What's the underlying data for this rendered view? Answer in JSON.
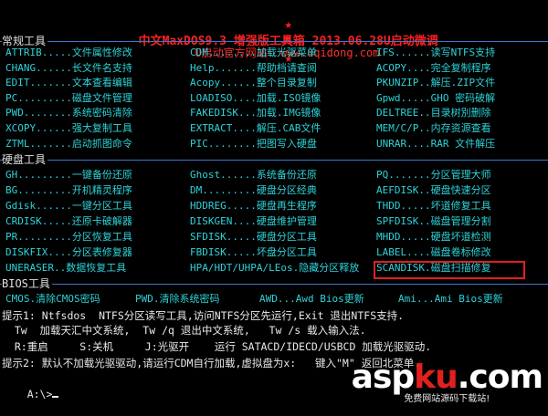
{
  "header": {
    "title": "中文MaxDOS9.3 增强版工具箱 2013.06.28U启动微调",
    "subtitle": "U启动官方网站: www.uqidong.com",
    "star": "★"
  },
  "sections": {
    "common": "常规工具",
    "disk": "硬盘工具",
    "bios": "BIOS工具"
  },
  "common_rows": [
    [
      {
        "cmd": "ATTRIB",
        "dots": ".....",
        "desc": "文件属性修改"
      },
      {
        "cmd": "CDM",
        "dots": "........",
        "desc": "加载光驱菜单"
      },
      {
        "cmd": "IFS",
        "dots": "......",
        "desc": "读写NTFS支持"
      }
    ],
    [
      {
        "cmd": "CHANG",
        "dots": "......",
        "desc": "长文件名支持"
      },
      {
        "cmd": "Help",
        "dots": ".......",
        "desc": "帮助档请查阅"
      },
      {
        "cmd": "ACOPY",
        "dots": "....",
        "desc": "完全复制程序"
      }
    ],
    [
      {
        "cmd": "EDIT",
        "dots": ".......",
        "desc": "文本查看编辑"
      },
      {
        "cmd": "Acopy",
        "dots": "......",
        "desc": "整个目录复制"
      },
      {
        "cmd": "PKUNZIP",
        "dots": "..",
        "desc": "解压.ZIP文件"
      }
    ],
    [
      {
        "cmd": "PC",
        "dots": ".........",
        "desc": "磁盘文件管理"
      },
      {
        "cmd": "LOADISO",
        "dots": "....",
        "desc": "加载.ISO镜像"
      },
      {
        "cmd": "Gpwd",
        "dots": ".....",
        "desc": "GHO 密码破解"
      }
    ],
    [
      {
        "cmd": "PWD",
        "dots": "........",
        "desc": "系统密码清除"
      },
      {
        "cmd": "FAKEDISK",
        "dots": "...",
        "desc": "加载.IMG镜像"
      },
      {
        "cmd": "DELTREE",
        "dots": "..",
        "desc": "目录树別删除"
      }
    ],
    [
      {
        "cmd": "XCOPY",
        "dots": "......",
        "desc": "强大复制工具"
      },
      {
        "cmd": "EXTRACT",
        "dots": "....",
        "desc": "解压.CAB文件"
      },
      {
        "cmd": "MEM/C/P",
        "dots": "..",
        "desc": "内存资源查看"
      }
    ],
    [
      {
        "cmd": "ZTML",
        "dots": ".......",
        "desc": "启动抓图命令"
      },
      {
        "cmd": "PIC",
        "dots": "........",
        "desc": "把图写入硬盘"
      },
      {
        "cmd": "UNRAR",
        "dots": "....",
        "desc": "RAR 文件解压"
      }
    ]
  ],
  "disk_rows": [
    [
      {
        "cmd": "GH",
        "dots": ".........",
        "desc": "一键备份还原"
      },
      {
        "cmd": "Ghost",
        "dots": "......",
        "desc": "系统备份还原"
      },
      {
        "cmd": "PQ",
        "dots": ".......",
        "desc": "分区管理大师"
      }
    ],
    [
      {
        "cmd": "BG",
        "dots": ".........",
        "desc": "开机精灵程序"
      },
      {
        "cmd": "DM",
        "dots": ".........",
        "desc": "硬盘分区经典"
      },
      {
        "cmd": "AEFDISK",
        "dots": "..",
        "desc": "硬盘快速分区"
      }
    ],
    [
      {
        "cmd": "Gdisk",
        "dots": "......",
        "desc": "一键分区工具"
      },
      {
        "cmd": "HDDREG",
        "dots": ".....",
        "desc": "硬盘再生程序"
      },
      {
        "cmd": "THDD",
        "dots": ".....",
        "desc": "坏道修复工具"
      }
    ],
    [
      {
        "cmd": "CRDISK",
        "dots": ".....",
        "desc": "还原卡破解器"
      },
      {
        "cmd": "DISKGEN",
        "dots": "....",
        "desc": "硬盘维护管理"
      },
      {
        "cmd": "SPFDISK",
        "dots": "..",
        "desc": "磁盘管理分割"
      }
    ],
    [
      {
        "cmd": "PR",
        "dots": ".........",
        "desc": "分区恢复工具"
      },
      {
        "cmd": "SFDISK",
        "dots": ".....",
        "desc": "硬盘分区工具"
      },
      {
        "cmd": "MHDD",
        "dots": ".....",
        "desc": "硬盘坏道检测"
      }
    ],
    [
      {
        "cmd": "DISKFIX",
        "dots": "....",
        "desc": "分区表修复器"
      },
      {
        "cmd": "FBDISK",
        "dots": ".....",
        "desc": "坏盘分区工具"
      },
      {
        "cmd": "LABEL",
        "dots": "....",
        "desc": "磁盘卷标修改"
      }
    ],
    [
      {
        "cmd": "UNERASER",
        "dots": "..",
        "desc": "数据恢复工具"
      },
      {
        "cmd": "HPA/HDT/UHPA/LEos",
        "dots": ".",
        "desc": "隐藏分区释放"
      },
      {
        "cmd": "SCANDISK",
        "dots": ".",
        "desc": "磁盘扫描修复"
      }
    ]
  ],
  "bios_row": [
    {
      "cmd": "CMOS",
      "dots": ".",
      "desc": "清除CMOS密码"
    },
    {
      "cmd": "PWD",
      "dots": ".",
      "desc": "清除系统密码"
    },
    {
      "cmd": "AWD",
      "dots": "...",
      "desc": "Awd Bios更新"
    },
    {
      "cmd": "Ami",
      "dots": "...",
      "desc": "Ami Bios更新"
    }
  ],
  "hints": [
    "提示1: Ntfsdos  NTFS分区读写工具,访问NTFS分区先运行,Exit 退出NTFS支持.",
    "  Tw  加载天汇中文系统,  Tw /q 退出中文系统,   Tw /s 载入输入法.",
    "  R:重启     S:关机     J:光驱开    运行 SATACD/IDECD/USBCD 加载光驱驱动.",
    "提示2: 默认不加载光驱驱动,请运行CDM自行加载,虚拟盘为x:   键入\"M\" 返回北菜单."
  ],
  "prompt": "A:\\>",
  "watermark": {
    "brand_a": "asp",
    "brand_b": "ku",
    "brand_c": ".com",
    "sub": "免费网站源码下载站!"
  }
}
